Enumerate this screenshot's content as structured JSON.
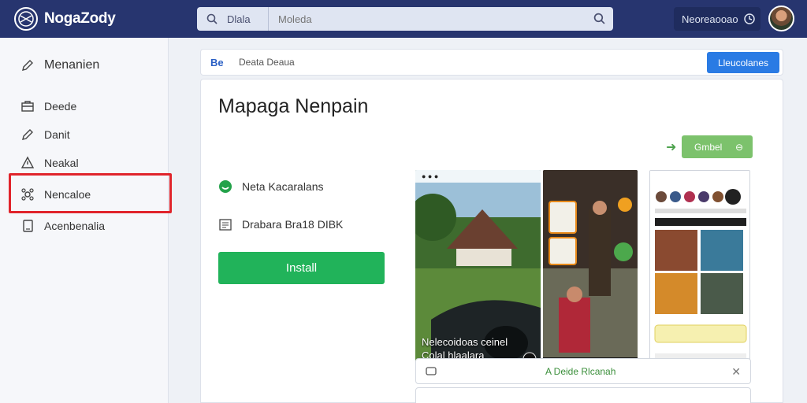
{
  "topbar": {
    "brand": "NogaZody",
    "search_label": "Dlala",
    "search_placeholder": "Moleda",
    "notifications_label": "Neoreaooao"
  },
  "sidebar": {
    "title": "Menanien",
    "items": [
      {
        "label": "Deede"
      },
      {
        "label": "Danit"
      },
      {
        "label": "Neakal"
      },
      {
        "label": "Nencaloe"
      },
      {
        "label": "Acenbenalia"
      }
    ],
    "highlighted_index": 3
  },
  "main": {
    "breadcrumb": "Deata Deaua",
    "header_button": "Lleucolanes",
    "app_title": "Mapaga Nenpain",
    "get_button": "Gmbel",
    "meta_developer": "Neta Kacaralans",
    "meta_info": "Drabara Bra18 DIBK",
    "install_button": "Install",
    "screenshot1_caption": [
      "Nelecoidoas ceinel",
      "Colal hlaalara"
    ],
    "tip_text": "A  Deide Rlcanah"
  },
  "colors": {
    "topbar": "#27356f",
    "install": "#21b35a",
    "accent_blue": "#2a7be4",
    "highlight_red": "#e0242b"
  }
}
